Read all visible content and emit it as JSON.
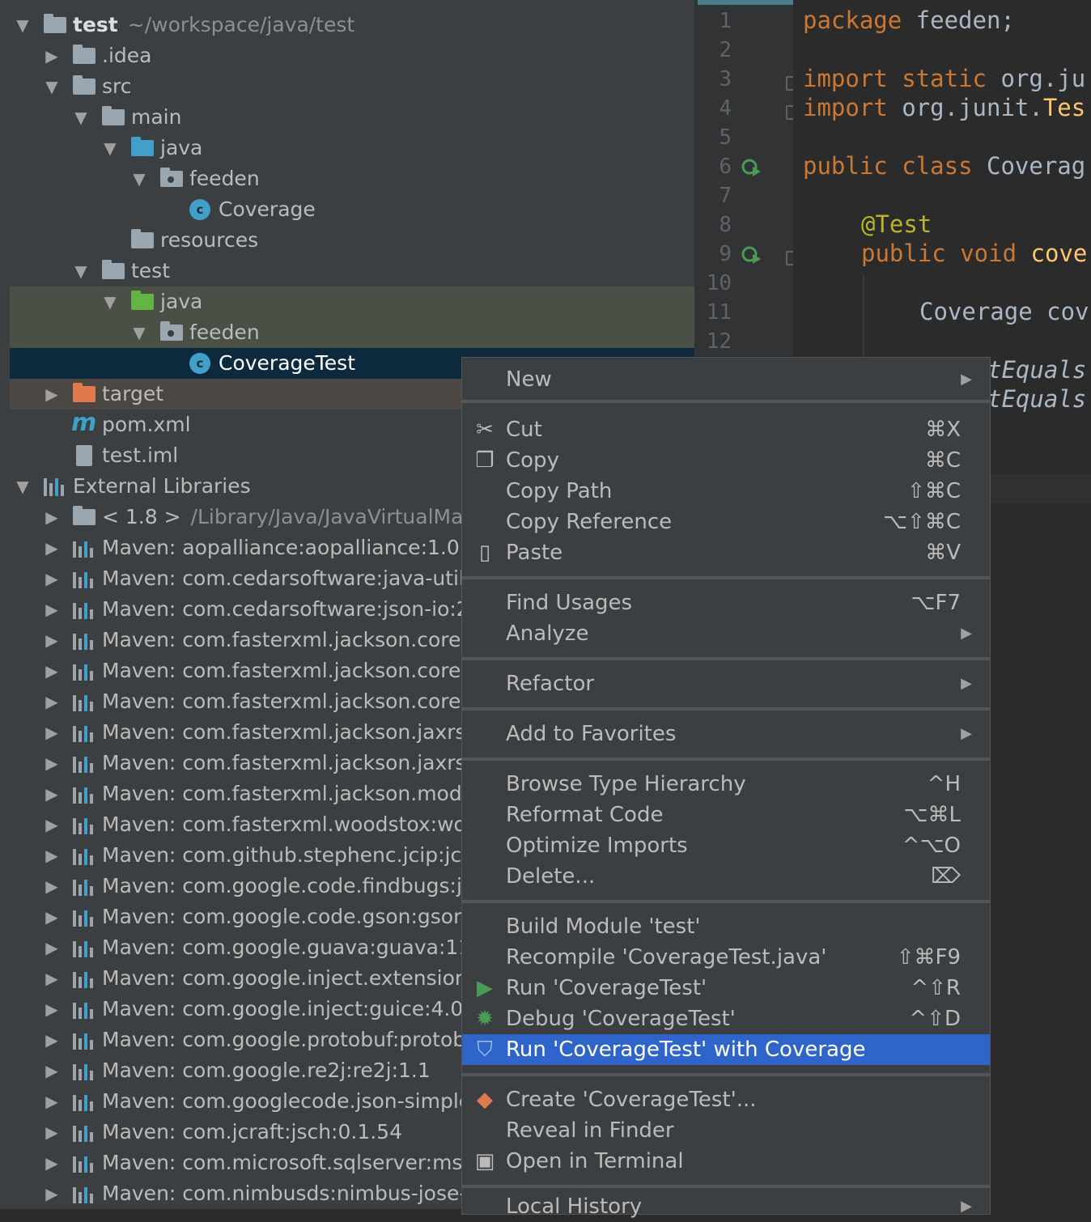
{
  "tree": {
    "rows": [
      {
        "label": "test",
        "sub": "~/workspace/java/test"
      },
      {
        "label": ".idea"
      },
      {
        "label": "src"
      },
      {
        "label": "main"
      },
      {
        "label": "java"
      },
      {
        "label": "feeden"
      },
      {
        "label": "Coverage"
      },
      {
        "label": "resources"
      },
      {
        "label": "test"
      },
      {
        "label": "java"
      },
      {
        "label": "feeden"
      },
      {
        "label": "CoverageTest"
      },
      {
        "label": "target"
      },
      {
        "label": "pom.xml"
      },
      {
        "label": "test.iml"
      },
      {
        "label": "External Libraries"
      },
      {
        "label": "< 1.8 >",
        "sub": "/Library/Java/JavaVirtualMac"
      },
      {
        "label": "Maven: aopalliance:aopalliance:1.0"
      },
      {
        "label": "Maven: com.cedarsoftware:java-util:"
      },
      {
        "label": "Maven: com.cedarsoftware:json-io:2"
      },
      {
        "label": "Maven: com.fasterxml.jackson.core:j"
      },
      {
        "label": "Maven: com.fasterxml.jackson.core:j"
      },
      {
        "label": "Maven: com.fasterxml.jackson.core:j"
      },
      {
        "label": "Maven: com.fasterxml.jackson.jaxrs:"
      },
      {
        "label": "Maven: com.fasterxml.jackson.jaxrs:"
      },
      {
        "label": "Maven: com.fasterxml.jackson.modu"
      },
      {
        "label": "Maven: com.fasterxml.woodstox:wo"
      },
      {
        "label": "Maven: com.github.stephenc.jcip:jci"
      },
      {
        "label": "Maven: com.google.code.findbugs:js"
      },
      {
        "label": "Maven: com.google.code.gson:gson"
      },
      {
        "label": "Maven: com.google.guava:guava:11."
      },
      {
        "label": "Maven: com.google.inject.extension"
      },
      {
        "label": "Maven: com.google.inject:guice:4.0"
      },
      {
        "label": "Maven: com.google.protobuf:protob"
      },
      {
        "label": "Maven: com.google.re2j:re2j:1.1"
      },
      {
        "label": "Maven: com.googlecode.json-simple"
      },
      {
        "label": "Maven: com.jcraft:jsch:0.1.54"
      },
      {
        "label": "Maven: com.microsoft.sqlserver:mss"
      },
      {
        "label": "Maven: com.nimbusds:nimbus-jose-"
      }
    ]
  },
  "editor": {
    "line_numbers": [
      "1",
      "2",
      "3",
      "4",
      "5",
      "6",
      "7",
      "8",
      "9",
      "10",
      "11",
      "12"
    ],
    "code": {
      "l1_kw": "package",
      "l1_rest": " feeden;",
      "l3_kw1": "import",
      "l3_kw2": " static",
      "l3_rest": " org.ju",
      "l4_kw": "import",
      "l4_rest": " org.junit.",
      "l4_cls": "Tes",
      "l6_kw1": "public",
      "l6_kw2": " class",
      "l6_rest": " Coverag",
      "l8_ann": "@Test",
      "l9_kw1": "public",
      "l9_kw2": " void",
      "l9_fn": " cove",
      "l11_rest": "Coverage cov",
      "l13_rest": "tEquals",
      "l14_rest": "tEquals"
    }
  },
  "menu": {
    "items": [
      {
        "label": "New",
        "shortcut": ""
      },
      {
        "label": "Cut",
        "shortcut": "⌘X"
      },
      {
        "label": "Copy",
        "shortcut": "⌘C"
      },
      {
        "label": "Copy Path",
        "shortcut": "⇧⌘C"
      },
      {
        "label": "Copy Reference",
        "shortcut": "⌥⇧⌘C"
      },
      {
        "label": "Paste",
        "shortcut": "⌘V"
      },
      {
        "label": "Find Usages",
        "shortcut": "⌥F7"
      },
      {
        "label": "Analyze",
        "shortcut": ""
      },
      {
        "label": "Refactor",
        "shortcut": ""
      },
      {
        "label": "Add to Favorites",
        "shortcut": ""
      },
      {
        "label": "Browse Type Hierarchy",
        "shortcut": "^H"
      },
      {
        "label": "Reformat Code",
        "shortcut": "⌥⌘L"
      },
      {
        "label": "Optimize Imports",
        "shortcut": "^⌥O"
      },
      {
        "label": "Delete...",
        "shortcut": "⌦"
      },
      {
        "label": "Build Module 'test'",
        "shortcut": ""
      },
      {
        "label": "Recompile 'CoverageTest.java'",
        "shortcut": "⇧⌘F9"
      },
      {
        "label": "Run 'CoverageTest'",
        "shortcut": "^⇧R"
      },
      {
        "label": "Debug 'CoverageTest'",
        "shortcut": "^⇧D"
      },
      {
        "label": "Run 'CoverageTest' with Coverage",
        "shortcut": ""
      },
      {
        "label": "Create 'CoverageTest'...",
        "shortcut": ""
      },
      {
        "label": "Reveal in Finder",
        "shortcut": ""
      },
      {
        "label": "Open in Terminal",
        "shortcut": ""
      },
      {
        "label": "Local History",
        "shortcut": ""
      }
    ]
  },
  "colors": {
    "accent": "#2f65ca",
    "selection": "#0d293e",
    "test_root": "#4a5045",
    "excluded": "#4c4742"
  }
}
